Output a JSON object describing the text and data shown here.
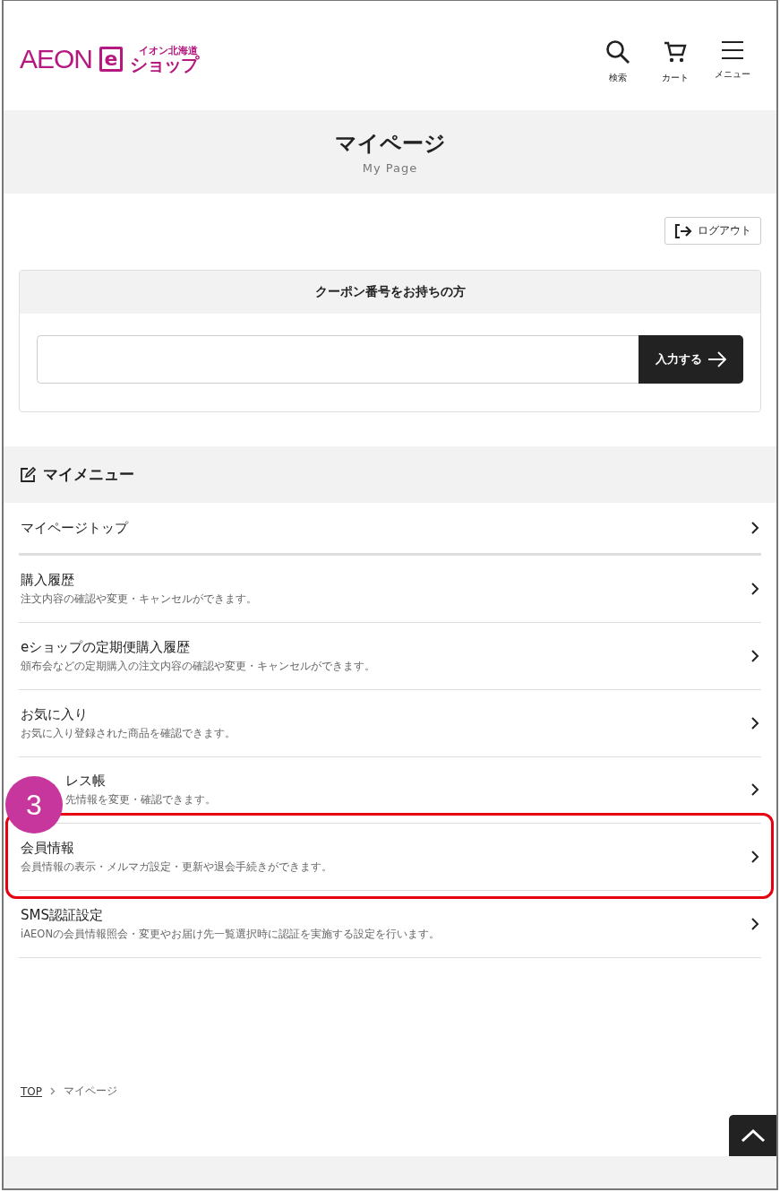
{
  "header": {
    "logo": {
      "brand": "AEON",
      "mark": "e",
      "region": "イオン北海道",
      "shop": "ショップ"
    },
    "actions": [
      {
        "kind": "search",
        "label": "検索"
      },
      {
        "kind": "cart",
        "label": "カート"
      },
      {
        "kind": "menu",
        "label": "メニュー"
      }
    ]
  },
  "page_title": {
    "title": "マイページ",
    "subtitle": "My Page"
  },
  "logout_button": "ログアウト",
  "coupon": {
    "heading": "クーポン番号をお持ちの方",
    "button": "入力する"
  },
  "my_menu": {
    "heading": "マイメニュー",
    "items": [
      {
        "title": "マイページトップ",
        "highlighted": false,
        "covered": false
      },
      {
        "title": "購入履歴",
        "description": "注文内容の確認や変更・キャンセルができます。",
        "highlighted": false,
        "covered": false
      },
      {
        "title": "eショップの定期便購入履歴",
        "description": "頒布会などの定期購入の注文内容の確認や変更・キャンセルができます。",
        "highlighted": false,
        "covered": false
      },
      {
        "title": "お気に入り",
        "description": "お気に入り登録された商品を確認できます。",
        "highlighted": false,
        "covered": false
      },
      {
        "title": "レス帳",
        "description": "先情報を変更・確認できます。",
        "highlighted": false,
        "covered": true
      },
      {
        "title": "会員情報",
        "description": "会員情報の表示・メルマガ設定・更新や退会手続きができます。",
        "highlighted": true,
        "covered": false
      },
      {
        "title": "SMS認証設定",
        "description": "iAEONの会員情報照会・変更やお届け先一覧選択時に認証を実施する設定を行います。",
        "highlighted": false,
        "covered": false
      }
    ]
  },
  "annotation": {
    "label": "3"
  },
  "breadcrumb": [
    {
      "label": "TOP",
      "link": true
    },
    {
      "label": "マイページ",
      "link": false
    }
  ]
}
